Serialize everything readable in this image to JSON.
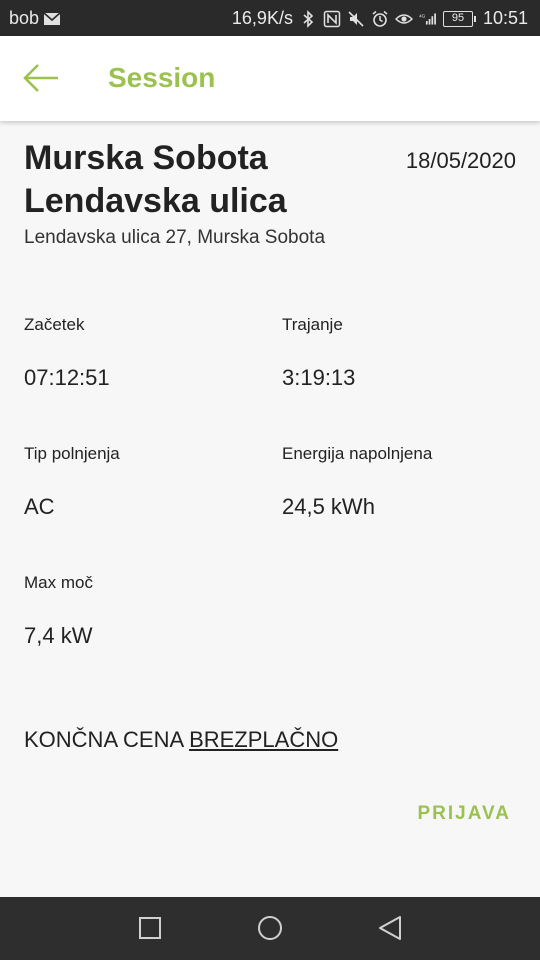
{
  "status_bar": {
    "carrier": "bob",
    "network_speed": "16,9K/s",
    "battery_level": "95",
    "time": "10:51",
    "network_type": "4G",
    "icons": [
      "mail-icon",
      "bluetooth-icon",
      "nfc-icon",
      "mute-icon",
      "alarm-icon",
      "eye-comfort-icon",
      "signal-icon",
      "battery-icon"
    ]
  },
  "app_bar": {
    "title": "Session",
    "back_icon": "arrow-left-icon"
  },
  "session": {
    "location_name_line1": "Murska Sobota",
    "location_name_line2": "Lendavska ulica",
    "date": "18/05/2020",
    "address": "Lendavska ulica 27, Murska Sobota",
    "fields": {
      "start": {
        "label": "Začetek",
        "value": "07:12:51"
      },
      "duration": {
        "label": "Trajanje",
        "value": "3:19:13"
      },
      "charge_type": {
        "label": "Tip polnjenja",
        "value": "AC"
      },
      "energy": {
        "label": "Energija napolnjena",
        "value": "24,5 kWh"
      },
      "max_power": {
        "label": "Max moč",
        "value": "7,4 kW"
      }
    },
    "final_price_label": "KONČNA CENA",
    "final_price_value": "BREZPLAČNO",
    "action_label": "PRIJAVA"
  },
  "colors": {
    "accent": "#9bc24f",
    "status_bar": "#2a2a2a",
    "nav_bar": "#2e2e2e",
    "background": "#f7f7f7"
  },
  "nav_bar": {
    "buttons": [
      "recent-apps-icon",
      "home-icon",
      "back-icon"
    ]
  }
}
